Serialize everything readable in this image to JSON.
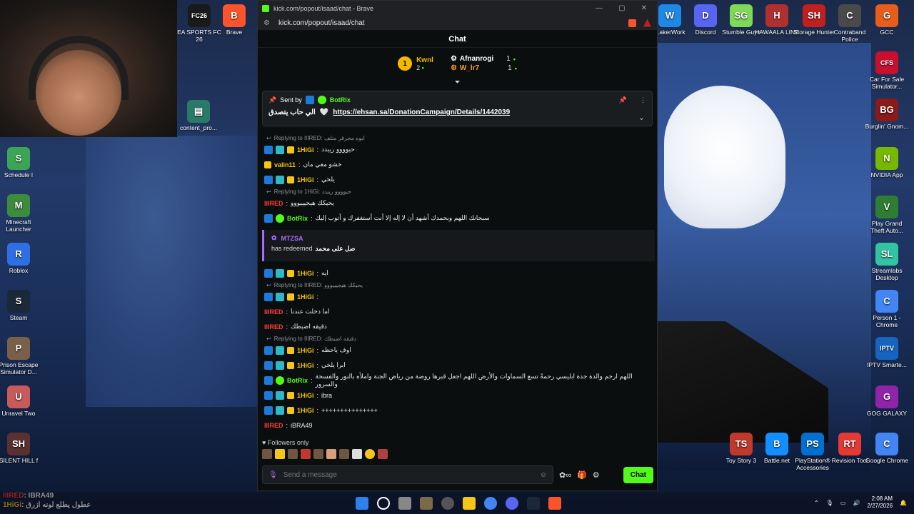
{
  "desktop_icons_left": [
    {
      "label": "EA SPORTS FC 26",
      "color": "#1a1a1a",
      "glyph": "FC26"
    },
    {
      "label": "Brave",
      "color": "#fb542b",
      "glyph": "B"
    },
    {
      "label": "Schedule I",
      "color": "#3aa655",
      "glyph": "S"
    },
    {
      "label": "Minecraft Launcher",
      "color": "#3d8b3d",
      "glyph": "M"
    },
    {
      "label": "Roblox",
      "color": "#2f6fe4",
      "glyph": "R"
    },
    {
      "label": "Steam",
      "color": "#1b2838",
      "glyph": "S"
    },
    {
      "label": "Prison Escape Simulator D...",
      "color": "#7a6048",
      "glyph": "P"
    },
    {
      "label": "Unravel Two",
      "color": "#c75a5a",
      "glyph": "U"
    },
    {
      "label": "SILENT HILL f",
      "color": "#5a3030",
      "glyph": "SH"
    }
  ],
  "content_pro_label": "content_pro...",
  "desktop_icons_right_top": [
    {
      "label": "...akerWork",
      "color": "#1e88e5",
      "glyph": "W"
    },
    {
      "label": "Discord",
      "color": "#5865f2",
      "glyph": "D"
    },
    {
      "label": "Stumble Guys",
      "color": "#7ed957",
      "glyph": "SG"
    },
    {
      "label": "HAWAALA LINE",
      "color": "#b03030",
      "glyph": "H"
    },
    {
      "label": "Storage Hunter",
      "color": "#c21f1f",
      "glyph": "SH"
    },
    {
      "label": "Contraband Police",
      "color": "#4a4a4a",
      "glyph": "C"
    },
    {
      "label": "GCC",
      "color": "#e85d1a",
      "glyph": "G"
    }
  ],
  "desktop_icons_right_col": [
    {
      "label": "Car For Sale Simulator...",
      "color": "#c8102e",
      "glyph": "CFS"
    },
    {
      "label": "Burglin' Gnom...",
      "color": "#8b1a1a",
      "glyph": "BG"
    },
    {
      "label": "NVIDIA App",
      "color": "#76b900",
      "glyph": "N"
    },
    {
      "label": "Play Grand Theft Auto...",
      "color": "#2e7d32",
      "glyph": "V"
    },
    {
      "label": "Streamlabs Desktop",
      "color": "#31c3a2",
      "glyph": "SL"
    },
    {
      "label": "Person 1 - Chrome",
      "color": "#4285f4",
      "glyph": "C"
    },
    {
      "label": "IPTV Smarte...",
      "color": "#1565c0",
      "glyph": "IPTV"
    },
    {
      "label": "GOG GALAXY",
      "color": "#8e24aa",
      "glyph": "G"
    }
  ],
  "desktop_icons_bottom_row": [
    {
      "label": "Toy Story 3",
      "color": "#c0392b",
      "glyph": "TS"
    },
    {
      "label": "Battle.net",
      "color": "#148eff",
      "glyph": "B"
    },
    {
      "label": "PlayStation® Accessories",
      "color": "#0070d1",
      "glyph": "PS"
    },
    {
      "label": "Revision Tool",
      "color": "#e53935",
      "glyph": "RT"
    },
    {
      "label": "Google Chrome",
      "color": "#4285f4",
      "glyph": "C"
    }
  ],
  "browser": {
    "window_title": "kick.com/popout/isaad/chat - Brave",
    "url": "kick.com/popout/isaad/chat",
    "chat_title": "Chat"
  },
  "leaderboard": {
    "rank": "1",
    "left_name": "Kwnl",
    "left_count": "2",
    "right_top_name": "Afnanrogi",
    "right_top_count": "1",
    "right_bottom_name": "W_lr7",
    "right_bottom_count": "1"
  },
  "pinned": {
    "sent_by": "Sent by",
    "user": "BotRix",
    "text": "الي حاب يتصدق",
    "link": "https://ehsan.sa/DonationCampaign/Details/1442039"
  },
  "messages": [
    {
      "kind": "reply",
      "text": "Replying to IIIRED: ابوه مجرقر متلف"
    },
    {
      "kind": "msg",
      "badges": [
        "mod",
        "sub",
        "gift"
      ],
      "user": "1HiGi",
      "ucls": "u-hi",
      "text": "حيوووو رييدد"
    },
    {
      "kind": "msg",
      "badges": [
        "gift"
      ],
      "user": "valin11",
      "ucls": "u-val",
      "text": "خشو معي مان"
    },
    {
      "kind": "msg",
      "badges": [
        "mod",
        "sub",
        "gift"
      ],
      "user": "1HiGi",
      "ucls": "u-hi",
      "text": "يلخي"
    },
    {
      "kind": "reply",
      "text": "Replying to 1HiGi: حيوووو رييدد"
    },
    {
      "kind": "msg",
      "badges": [],
      "user": "IIIRED",
      "ucls": "u-red",
      "text": "يحيكك هيجيييووو"
    },
    {
      "kind": "msg",
      "badges": [
        "mod",
        "bot"
      ],
      "user": "BotRix",
      "ucls": "u-bot",
      "text": "سبحانك اللهم وبحمدك أشهد أن لا إله إلا أنت أستغفرك و أتوب إليك"
    }
  ],
  "redeem": {
    "user": "MTZSA",
    "action": "has redeemed",
    "reward": "صل على محمد"
  },
  "messages2": [
    {
      "kind": "msg",
      "badges": [
        "mod",
        "sub",
        "gift"
      ],
      "user": "1HiGi",
      "ucls": "u-hi",
      "text": "ايه"
    },
    {
      "kind": "reply",
      "text": "Replying to IIIRED: يحيكك هيجيييووو"
    },
    {
      "kind": "msg",
      "badges": [
        "mod",
        "sub",
        "gift"
      ],
      "user": "1HiGi",
      "ucls": "u-hi",
      "text": ""
    },
    {
      "kind": "msg",
      "badges": [],
      "user": "IIIRED",
      "ucls": "u-red",
      "text": "اما دخلت عندنا"
    },
    {
      "kind": "msg",
      "badges": [],
      "user": "IIIRED",
      "ucls": "u-red",
      "text": "دقيقه اضبطك"
    },
    {
      "kind": "reply",
      "text": "Replying to IIIRED: دقيقه اضبطك"
    },
    {
      "kind": "msg",
      "badges": [
        "mod",
        "sub",
        "gift"
      ],
      "user": "1HiGi",
      "ucls": "u-hi",
      "text": "اوف ياحظه"
    },
    {
      "kind": "msg",
      "badges": [
        "mod",
        "sub",
        "gift"
      ],
      "user": "1HiGi",
      "ucls": "u-hi",
      "text": "ابرا يلخي"
    },
    {
      "kind": "msg",
      "badges": [
        "mod",
        "bot"
      ],
      "user": "BotRix",
      "ucls": "u-bot",
      "text": "اللهم ارحم والدة جدة ابليسي رحمةً تسع السماوات والأرض اللهم اجعل قبرها روضة من رياض الجنة واملأه بالنور والفسحة والسرور"
    },
    {
      "kind": "msg",
      "badges": [
        "mod",
        "sub",
        "gift"
      ],
      "user": "1HiGi",
      "ucls": "u-hi",
      "text": "ibra"
    },
    {
      "kind": "msg",
      "badges": [
        "mod",
        "sub",
        "gift"
      ],
      "user": "1HiGi",
      "ucls": "u-hi",
      "text": "+++++++++++++++"
    },
    {
      "kind": "msg",
      "badges": [],
      "user": "IIIRED",
      "ucls": "u-red",
      "text": "iBRA49"
    },
    {
      "kind": "msg",
      "badges": [
        "mod",
        "sub",
        "gift"
      ],
      "user": "1HiGi",
      "ucls": "u-hi",
      "text": "عطول يطلع لونه ازرق"
    }
  ],
  "followers_only": "Followers only",
  "input": {
    "placeholder": "Send a message",
    "chat_button": "Chat"
  },
  "overlay": {
    "line1_user": "IIIRED",
    "line1_text": ": IBRA49",
    "line2_user": "1HiGi",
    "line2_text": ": عطول يطلع لونه ازرق"
  },
  "clock": {
    "time": "2:08 AM",
    "date": "2/27/2026"
  },
  "colors": {
    "kick_green": "#53fc18",
    "redeem_purple": "#a66cff",
    "gold": "#f5c518",
    "red_user": "#ff3b3b"
  }
}
